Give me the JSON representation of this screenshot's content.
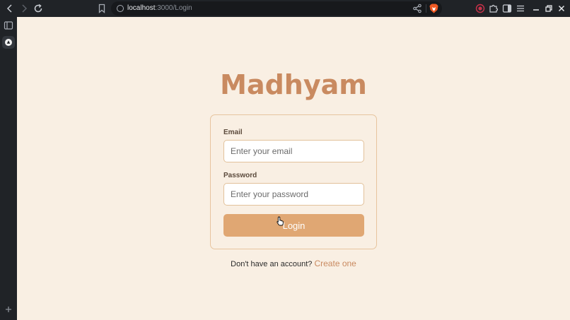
{
  "browser": {
    "url_host": "localhost",
    "url_path": ":3000/Login"
  },
  "page": {
    "brand_title": "Madhyam",
    "email": {
      "label": "Email",
      "placeholder": "Enter your email",
      "value": ""
    },
    "password": {
      "label": "Password",
      "placeholder": "Enter your password",
      "value": ""
    },
    "login_label": "Login",
    "signup_prompt": "Don't have an account?",
    "signup_link": "Create one"
  },
  "colors": {
    "page_bg": "#f9efe3",
    "brand": "#c98a60",
    "button": "#e0a773",
    "card_border": "#e7c49e"
  },
  "icons": {
    "back": "chevron-left-icon",
    "forward": "chevron-right-icon",
    "reload": "reload-icon",
    "bookmark": "bookmark-icon",
    "site_info": "info-icon",
    "share": "share-icon",
    "brave": "brave-shield-icon",
    "record": "record-icon",
    "extensions": "puzzle-icon",
    "sidebar": "sidebar-icon",
    "menu": "hamburger-menu-icon",
    "minimize": "minimize-icon",
    "maximize": "maximize-icon",
    "close": "close-icon"
  }
}
